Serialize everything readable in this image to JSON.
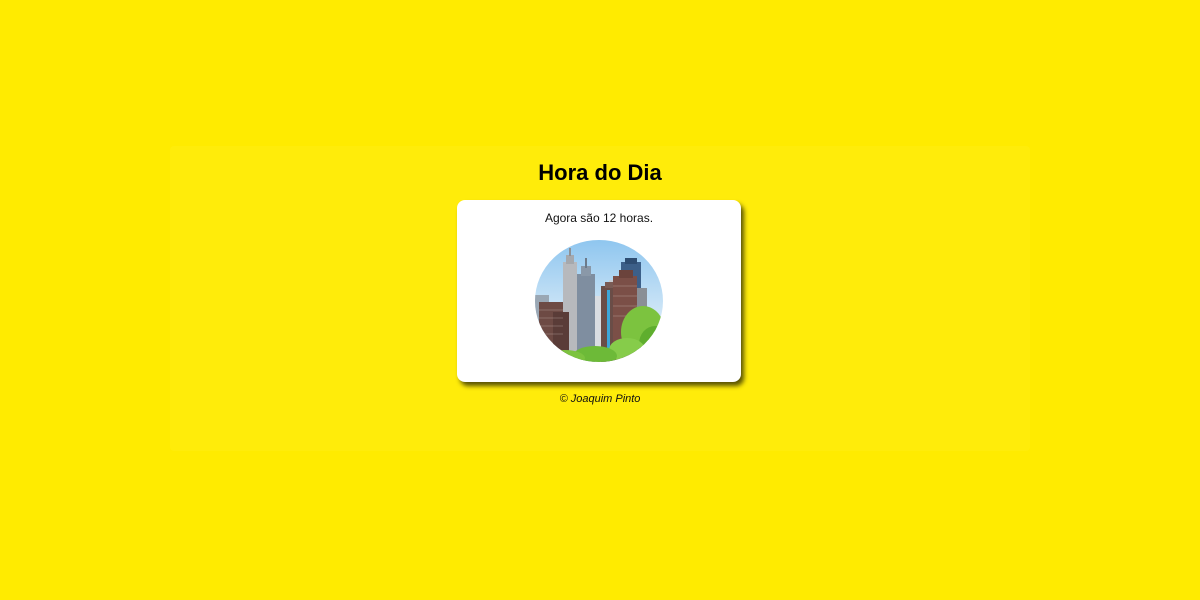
{
  "header": {
    "title": "Hora do Dia"
  },
  "card": {
    "message": "Agora são 12 horas.",
    "image_subject": "city-skyline-noon"
  },
  "footer": {
    "credit": "© Joaquim Pinto"
  },
  "colors": {
    "background": "#ffeb00",
    "card": "#ffffff",
    "text": "#000000"
  }
}
